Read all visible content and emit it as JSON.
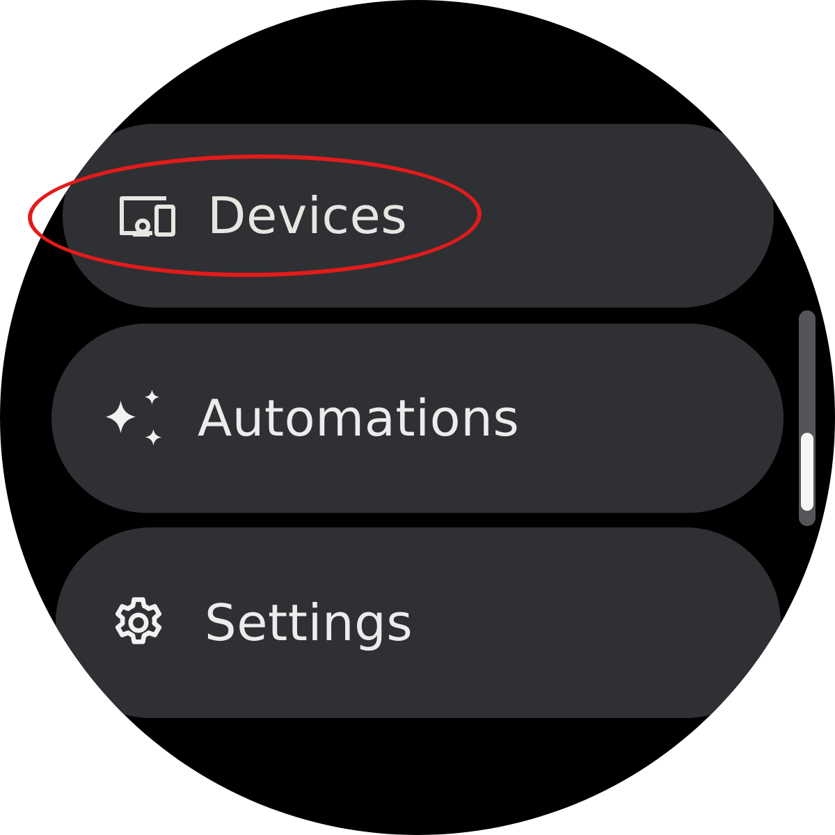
{
  "menu": {
    "items": [
      {
        "label": "Devices",
        "icon": "devices-icon"
      },
      {
        "label": "Automations",
        "icon": "sparkle-icon"
      },
      {
        "label": "Settings",
        "icon": "gear-icon"
      }
    ]
  },
  "scrollbar": {
    "position": 0.55
  },
  "annotation": {
    "highlighted_item": "Devices",
    "color": "#e31b1b"
  },
  "colors": {
    "background": "#000000",
    "chip": "#2f3033",
    "text": "#ececec",
    "annotation": "#e31b1b"
  }
}
